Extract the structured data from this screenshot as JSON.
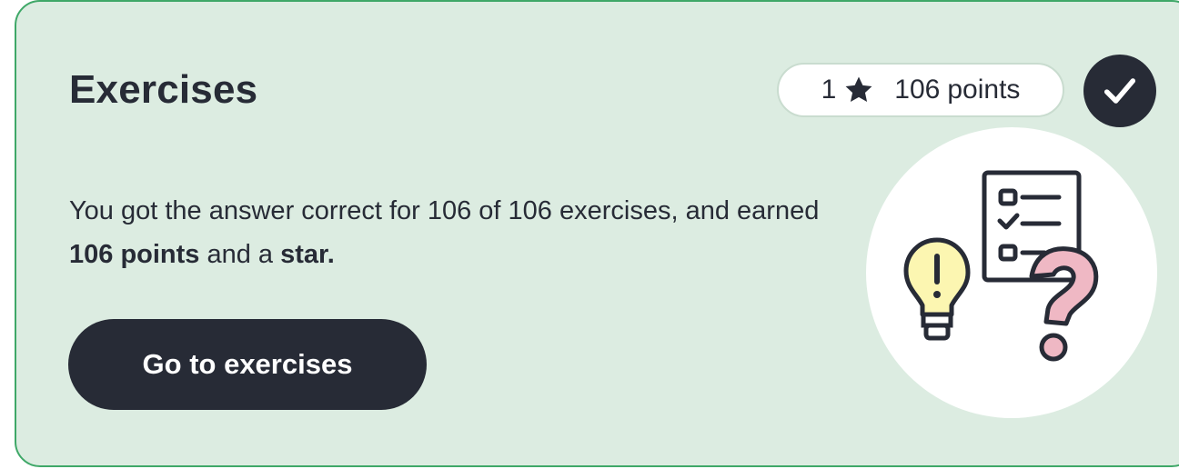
{
  "card": {
    "title": "Exercises",
    "summary": {
      "sentence_start": "You got the answer correct for 106 of 106 exercises, and earned",
      "points_bold": "106 points",
      "middle": " and a ",
      "star_bold": "star."
    },
    "button_label": "Go to exercises",
    "badge": {
      "star_count": "1",
      "points_value": "106",
      "points_label": "points",
      "star_icon": "star-icon"
    },
    "status_icon": "checkmark-icon",
    "illustration_icon": "exercise-illustration"
  },
  "colors": {
    "card_background": "#dcece1",
    "card_border": "#3fa868",
    "dark": "#272b36",
    "bulb": "#fcf6b1",
    "question_mark": "#efb8c4"
  }
}
